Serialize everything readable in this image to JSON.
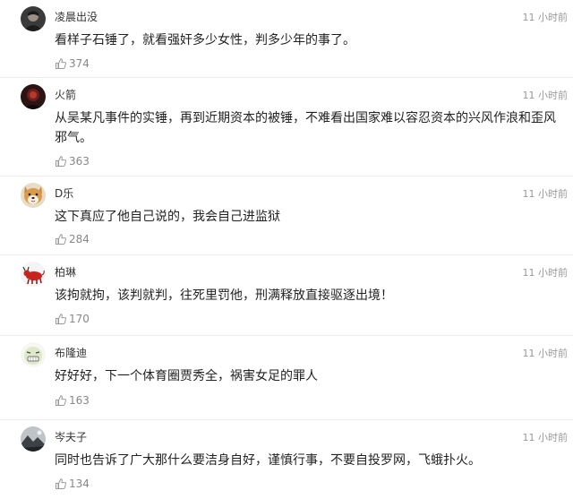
{
  "comments": [
    {
      "username": "凌晨出没",
      "time": "11 小时前",
      "text": "看样子石锤了，就看强奸多少女性，判多少年的事了。",
      "likes": "374",
      "avatar_icon": "dark-portrait-avatar"
    },
    {
      "username": "火箭",
      "time": "11 小时前",
      "text": "从吴某凡事件的实锤，再到近期资本的被锤，不难看出国家难以容忍资本的兴风作浪和歪风邪气。",
      "likes": "363",
      "avatar_icon": "dark-red-portrait-avatar"
    },
    {
      "username": "D乐",
      "time": "11 小时前",
      "text": "这下真应了他自己说的，我会自己进监狱",
      "likes": "284",
      "avatar_icon": "shiba-dog-avatar"
    },
    {
      "username": "柏琳",
      "time": "11 小时前",
      "text": "该拘就拘，该判就判，往死里罚他，刑满释放直接驱逐出境！",
      "likes": "170",
      "avatar_icon": "red-bull-avatar"
    },
    {
      "username": "布隆迪",
      "time": "11 小时前",
      "text": "好好好，下一个体育圈贾秀全，祸害女足的罪人",
      "likes": "163",
      "avatar_icon": "meme-face-avatar"
    },
    {
      "username": "岑夫子",
      "time": "11 小时前",
      "text": "同时也告诉了广大那什么要洁身自好，谨慎行事，不要自投罗网，飞蛾扑火。",
      "likes": "134",
      "avatar_icon": "landscape-avatar"
    }
  ],
  "like_icon": "thumbs-up-icon"
}
